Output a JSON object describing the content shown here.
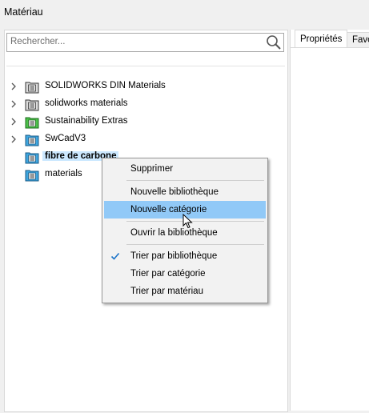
{
  "window": {
    "title": "Matériau"
  },
  "search": {
    "placeholder": "Rechercher..."
  },
  "tree": {
    "items": [
      {
        "label": "SOLIDWORKS DIN Materials",
        "icon": "library-icon",
        "icon_color": "#dcdcdc",
        "expandable": true
      },
      {
        "label": "solidworks materials",
        "icon": "library-icon",
        "icon_color": "#dcdcdc",
        "expandable": true
      },
      {
        "label": "Sustainability Extras",
        "icon": "library-icon",
        "icon_color": "#4cc24a",
        "expandable": true
      },
      {
        "label": "SwCadV3",
        "icon": "library-icon",
        "icon_color": "#3fa7e0",
        "expandable": true
      },
      {
        "label": "fibre de carbone",
        "icon": "library-icon",
        "icon_color": "#3fa7e0",
        "expandable": false,
        "selected": true
      },
      {
        "label": "materials",
        "icon": "library-icon",
        "icon_color": "#3fa7e0",
        "expandable": false
      }
    ]
  },
  "tabs": [
    {
      "label": "Propriétés",
      "active": true
    },
    {
      "label": "Favo",
      "active": false
    }
  ],
  "context_menu": {
    "items": [
      {
        "label": "Supprimer"
      },
      {
        "label": "Nouvelle bibliothèque"
      },
      {
        "label": "Nouvelle catégorie",
        "highlighted": true
      },
      {
        "label": "Ouvrir la bibliothèque"
      },
      {
        "label": "Trier par bibliothèque",
        "checked": true
      },
      {
        "label": "Trier par catégorie"
      },
      {
        "label": "Trier par matériau"
      }
    ]
  },
  "colors": {
    "selection": "#cce8ff",
    "menu_highlight": "#91c9f7",
    "check": "#1a73c9"
  }
}
